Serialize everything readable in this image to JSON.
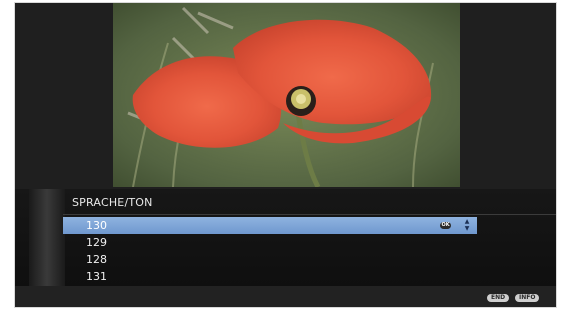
{
  "menu": {
    "title": "SPRACHE/TON",
    "items": [
      {
        "label": "130",
        "selected": true
      },
      {
        "label": "129",
        "selected": false
      },
      {
        "label": "128",
        "selected": false
      },
      {
        "label": "131",
        "selected": false
      }
    ],
    "ok_label": "OK",
    "arrow_up": "▲",
    "arrow_down": "▼"
  },
  "footer": {
    "end_label": "END",
    "info_label": "INFO"
  },
  "colors": {
    "selection": "#7aa2d6",
    "background": "#1f1f1f"
  },
  "icons": {
    "photo": "poppy-flower-image",
    "ok": "ok-badge-icon",
    "scroll": "up-down-arrows-icon"
  }
}
